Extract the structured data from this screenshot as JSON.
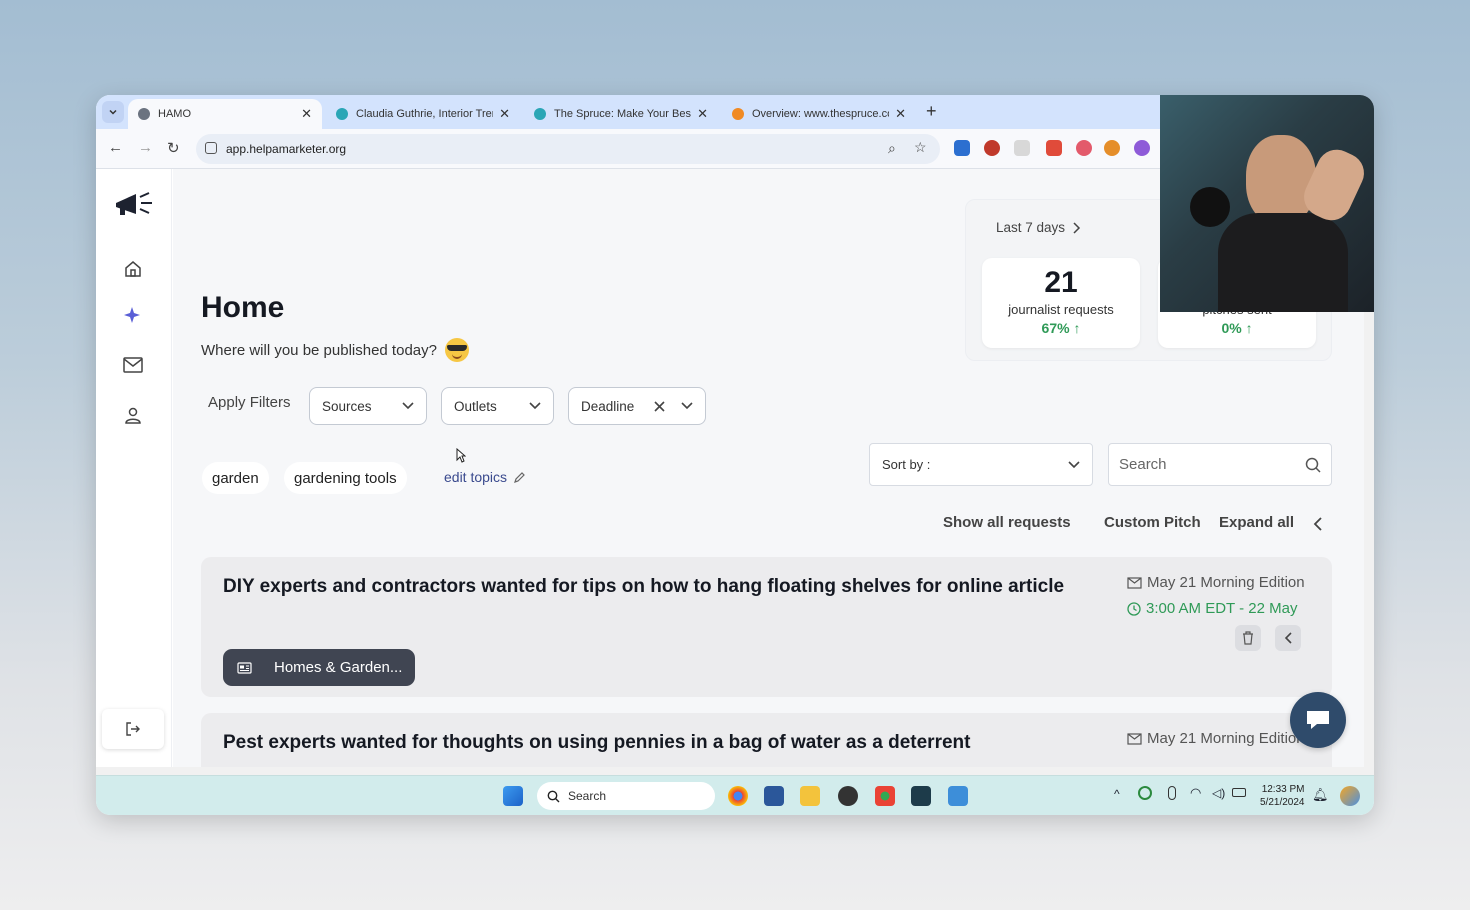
{
  "browser": {
    "tabs": [
      {
        "title": "HAMO",
        "active": true
      },
      {
        "title": "Claudia Guthrie, Interior Trends",
        "active": false
      },
      {
        "title": "The Spruce: Make Your Best Ho",
        "active": false
      },
      {
        "title": "Overview: www.thespruce.com/",
        "active": false
      }
    ],
    "url": "app.helpamarketer.org"
  },
  "page": {
    "title": "Home",
    "subtitle": "Where will you be published today?",
    "apply_filters": "Apply Filters",
    "filters": {
      "sources": "Sources",
      "outlets": "Outlets",
      "deadline": "Deadline"
    },
    "topics": [
      "garden",
      "gardening tools"
    ],
    "edit_topics": "edit topics",
    "sort_label": "Sort by :",
    "search_placeholder": "Search",
    "actions": {
      "show_all": "Show all requests",
      "custom_pitch": "Custom Pitch",
      "expand_all": "Expand all"
    }
  },
  "stats": {
    "period": "Last 7 days",
    "journalist_requests": {
      "value": "21",
      "label": "journalist requests",
      "change": "67%"
    },
    "pitches": {
      "label": "pitches sent",
      "change": "0%"
    }
  },
  "requests": [
    {
      "title": "DIY experts and contractors wanted for tips on how to hang floating shelves for online article",
      "edition": "May 21 Morning Edition",
      "deadline": "3:00 AM EDT - 22 May",
      "category": "Homes & Garden..."
    },
    {
      "title": "Pest experts wanted for thoughts on using pennies in a bag of water as a deterrent",
      "edition": "May 21 Morning Edition"
    }
  ],
  "taskbar": {
    "search": "Search",
    "time": "12:33 PM",
    "date": "5/21/2024"
  },
  "colors": {
    "green": "#2f9a57",
    "chip_dark": "#404552",
    "link": "#3a4a8e",
    "chat": "#2f4b6b"
  }
}
